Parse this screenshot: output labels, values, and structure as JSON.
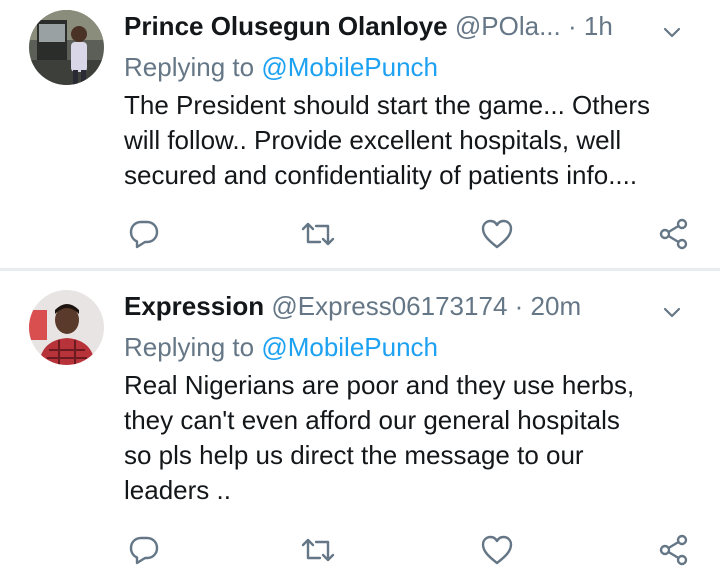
{
  "tweets": [
    {
      "name": "Prince Olusegun Olanloye",
      "handle": "@POla...",
      "separator": "·",
      "time": "1h",
      "replying_prefix": "Replying to",
      "replying_to": "@MobilePunch",
      "lines": [
        "The President should start the game... Others",
        "will follow.. Provide excellent hospitals, well",
        "secured and confidentiality of patients info...."
      ]
    },
    {
      "name": "Expression",
      "handle": "@Express06173174",
      "separator": "·",
      "time": "20m",
      "replying_prefix": "Replying to",
      "replying_to": "@MobilePunch",
      "lines": [
        "Real Nigerians are poor and they use herbs,",
        "they can't even afford our general hospitals",
        "so pls help us direct the message to our",
        "leaders .."
      ]
    }
  ],
  "icons": {
    "reply": "reply-icon",
    "retweet": "retweet-icon",
    "like": "heart-icon",
    "share": "share-icon",
    "menu": "chevron-down-icon"
  },
  "colors": {
    "text": "#14171a",
    "secondary": "#657786",
    "accent": "#1da1f2",
    "divider": "#e6ecf0"
  }
}
